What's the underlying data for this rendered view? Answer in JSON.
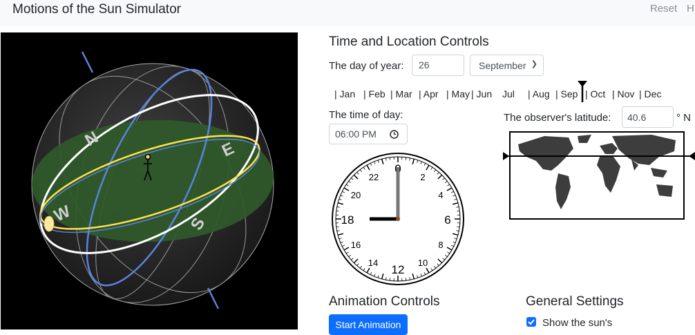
{
  "header": {
    "title": "Motions of the Sun Simulator",
    "reset_label": "Reset",
    "help_label": "H"
  },
  "simulator": {
    "horizon_labels": [
      "N",
      "E",
      "S",
      "W"
    ]
  },
  "time_location": {
    "title": "Time and Location Controls",
    "day_label": "The day of year:",
    "day_value": "26",
    "month_value": "September",
    "months": [
      "Jan",
      "Feb",
      "Mar",
      "Apr",
      "May",
      "Jun",
      "Jul",
      "Aug",
      "Sep",
      "Oct",
      "Nov",
      "Dec"
    ],
    "time_label": "The time of day:",
    "time_value": "06:00 PM",
    "latitude_label": "The observer's latitude:",
    "latitude_value": "40.6",
    "latitude_unit": "° N",
    "clock_numbers": [
      "0",
      "2",
      "4",
      "6",
      "8",
      "10",
      "12",
      "14",
      "16",
      "18",
      "20",
      "22"
    ]
  },
  "animation": {
    "title": "Animation Controls",
    "start_label": "Start Animation"
  },
  "general": {
    "title": "General Settings",
    "show_sun_label": "Show the sun's"
  },
  "colors": {
    "accent": "#0d6efd",
    "horizon_plane": "#2f5a2a",
    "sun_path": "#ffe24d",
    "celestial_equator": "#ffffff",
    "meridian": "#5b83e0"
  }
}
